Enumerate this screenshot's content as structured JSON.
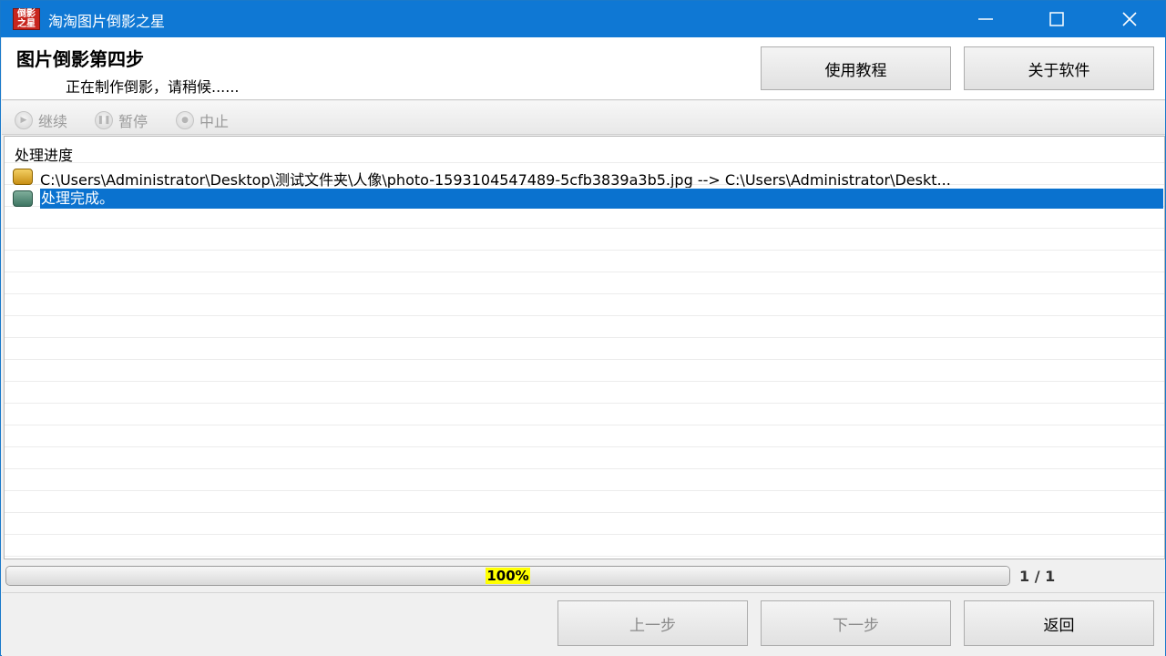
{
  "window": {
    "title": "淘淘图片倒影之星",
    "icon_text": "倒影之星",
    "controls": [
      "minimize-icon",
      "maximize-icon",
      "close-icon"
    ]
  },
  "header": {
    "step_title": "图片倒影第四步",
    "status": "正在制作倒影，请稍候......",
    "tutorial_label": "使用教程",
    "about_label": "关于软件"
  },
  "toolbar": {
    "continue_label": "继续",
    "pause_label": "暂停",
    "stop_label": "中止"
  },
  "log": {
    "header": "处理进度",
    "rows": [
      {
        "icon": "folder-icon",
        "text": "C:\\Users\\Administrator\\Desktop\\测试文件夹\\人像\\photo-1593104547489-5cfb3839a3b5.jpg  -->  C:\\Users\\Administrator\\Deskt..."
      },
      {
        "icon": "done-icon",
        "text": "处理完成。",
        "selected": true
      }
    ]
  },
  "progress": {
    "percent_label": "100%",
    "fraction": 1.0,
    "count_label": "1 / 1"
  },
  "footer": {
    "prev_label": "上一步",
    "next_label": "下一步",
    "back_label": "返回"
  },
  "colors": {
    "titlebar": "#0f78d4",
    "selection": "#0a72cf",
    "progress_label_bg": "#ffff00"
  }
}
